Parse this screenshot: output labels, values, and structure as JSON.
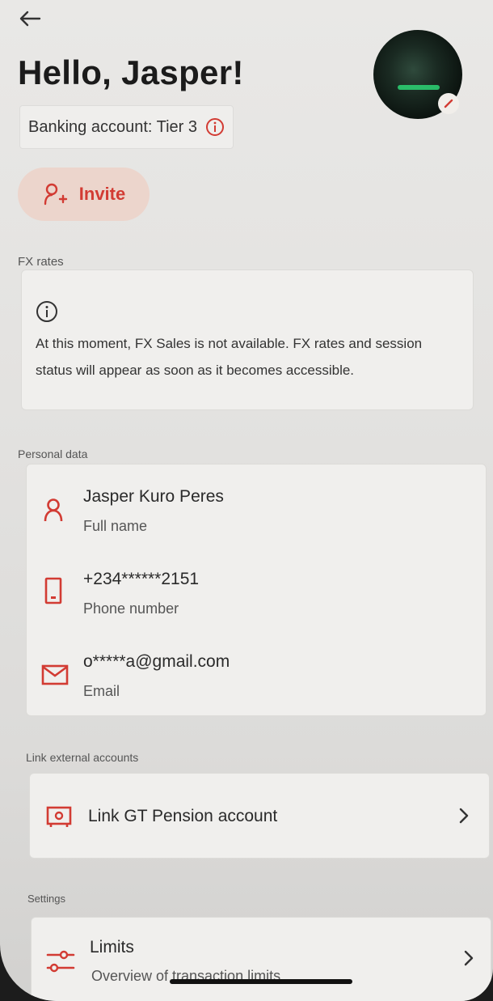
{
  "header": {
    "greeting": "Hello, Jasper!",
    "tier_label": "Banking account: Tier 3",
    "invite_label": "Invite"
  },
  "fx": {
    "section_title": "FX rates",
    "message": "At this moment, FX Sales is not available. FX rates and session status will appear as soon as it becomes accessible."
  },
  "personal": {
    "section_title": "Personal data",
    "rows": [
      {
        "value": "Jasper Kuro Peres",
        "label": "Full name",
        "icon": "person-icon"
      },
      {
        "value": "+234******2151",
        "label": "Phone number",
        "icon": "phone-icon"
      },
      {
        "value": "o*****a@gmail.com",
        "label": "Email",
        "icon": "mail-icon"
      }
    ]
  },
  "external": {
    "section_title": "Link external accounts",
    "link_label": "Link GT Pension account"
  },
  "settings": {
    "section_title": "Settings",
    "limits_label": "Limits",
    "limits_sub": "Overview of transaction limits"
  },
  "colors": {
    "accent": "#d23b33",
    "invite_bg": "#ecd5cc",
    "card_bg": "#f0efed"
  }
}
